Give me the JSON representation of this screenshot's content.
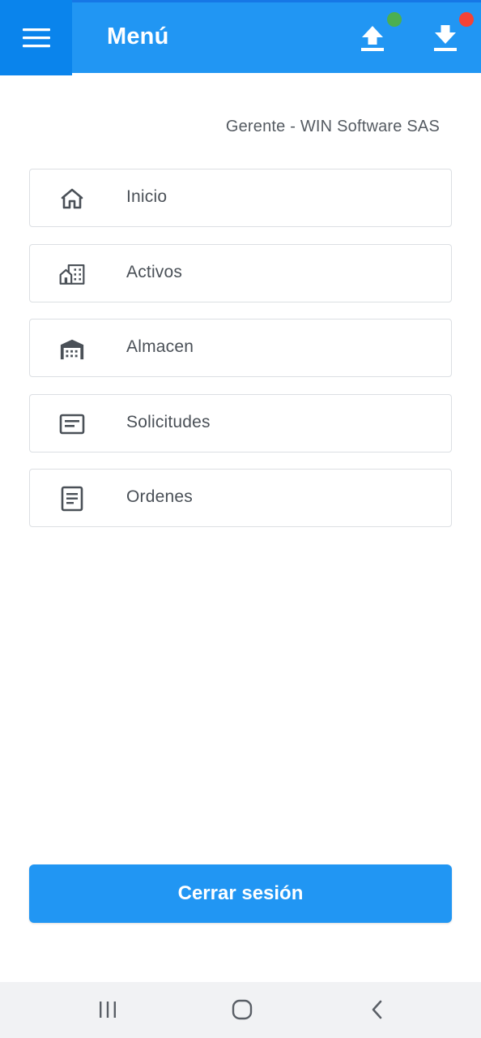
{
  "header": {
    "title": "Menú",
    "menu_icon": "hamburger-menu-icon",
    "upload_icon": "upload-icon",
    "download_icon": "download-icon",
    "upload_status_color": "#4CAF50",
    "download_status_color": "#F44336",
    "bar_color": "#2196F3"
  },
  "user": {
    "label": "Gerente - WIN Software SAS"
  },
  "menu": {
    "items": [
      {
        "label": "Inicio",
        "icon": "home-icon"
      },
      {
        "label": "Activos",
        "icon": "buildings-icon"
      },
      {
        "label": "Almacen",
        "icon": "warehouse-icon"
      },
      {
        "label": "Solicitudes",
        "icon": "message-icon"
      },
      {
        "label": "Ordenes",
        "icon": "document-icon"
      }
    ]
  },
  "footer": {
    "logout_label": "Cerrar sesión"
  },
  "system_nav": {
    "recents_icon": "recents-icon",
    "home_icon": "home-circle-icon",
    "back_icon": "back-chevron-icon"
  }
}
